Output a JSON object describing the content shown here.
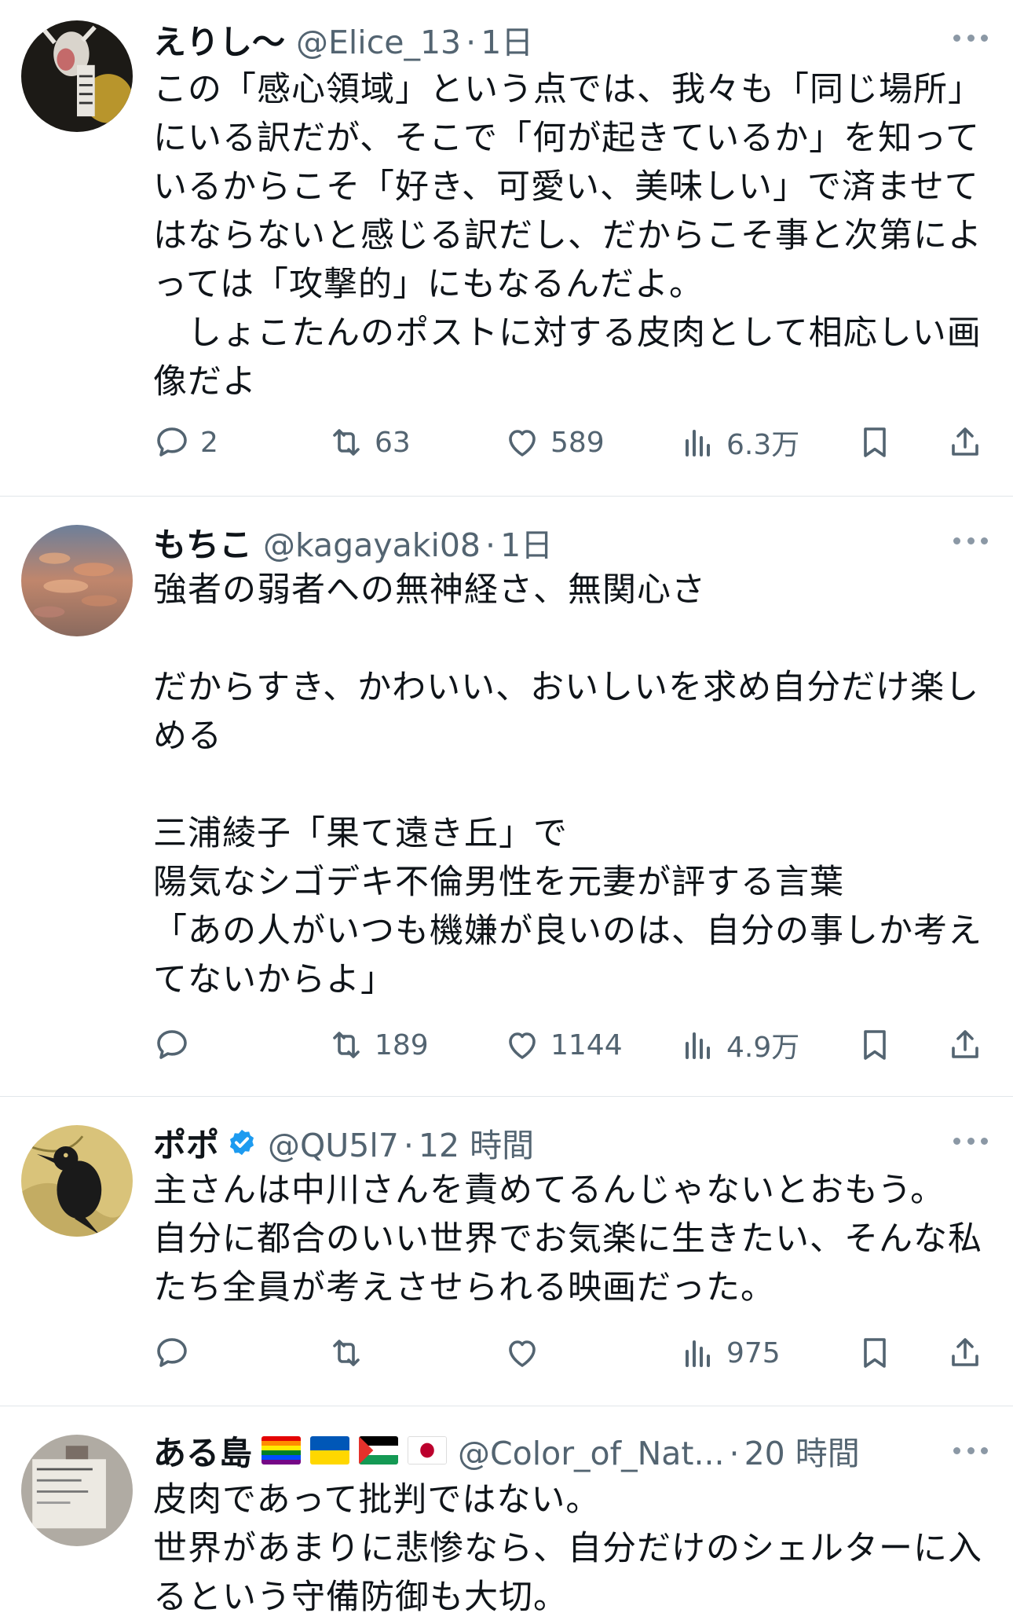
{
  "tweets": [
    {
      "name": "えりし〜",
      "handle": "@Elice_13",
      "time": "1日",
      "verified": false,
      "text": "この「感心領域」という点では、我々も「同じ場所」にいる訳だが、そこで「何が起きているか」を知っているからこそ「好き、可愛い、美味しい」で済ませてはならないと感じる訳だし、だからこそ事と次第によっては「攻撃的」にもなるんだよ。\n　しょこたんのポストに対する皮肉として相応しい画像だよ",
      "replies": "2",
      "retweets": "63",
      "likes": "589",
      "views": "6.3万"
    },
    {
      "name": "もちこ",
      "handle": "@kagayaki08",
      "time": "1日",
      "verified": false,
      "text": "強者の弱者への無神経さ、無関心さ\n\nだからすき、かわいい、おいしいを求め自分だけ楽しめる\n\n三浦綾子「果て遠き丘」で\n陽気なシゴデキ不倫男性を元妻が評する言葉\n「あの人がいつも機嫌が良いのは、自分の事しか考えてないからよ」",
      "replies": "",
      "retweets": "189",
      "likes": "1144",
      "views": "4.9万"
    },
    {
      "name": "ポポ",
      "handle": "@QU5l7",
      "time": "12 時間",
      "verified": true,
      "text": "主さんは中川さんを責めてるんじゃないとおもう。\n自分に都合のいい世界でお気楽に生きたい、そんな私たち全員が考えさせられる映画だった。",
      "replies": "",
      "retweets": "",
      "likes": "",
      "views": "975"
    },
    {
      "name": "ある島",
      "handle": "@Color_of_Nat...",
      "time": "20 時間",
      "verified": false,
      "flags": [
        "rainbow-flag-icon",
        "ukraine-flag-icon",
        "palestine-flag-icon",
        "japan-flag-icon"
      ],
      "text": "皮肉であって批判ではない。\n世界があまりに悲惨なら、自分だけのシェルターに入るという守備防御も大切。",
      "replies": "",
      "retweets": "",
      "likes": "",
      "views": ""
    }
  ],
  "colors": {
    "text": "#0f1419",
    "secondary": "#536471",
    "divider": "#e1e6ea",
    "verified": "#1d9bf0"
  }
}
